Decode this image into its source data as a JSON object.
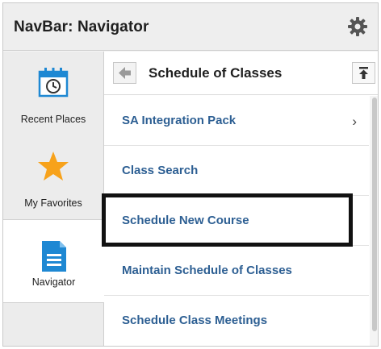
{
  "window": {
    "title": "NavBar: Navigator"
  },
  "rail": {
    "items": [
      {
        "label": "Recent Places",
        "icon": "calendar-clock-icon"
      },
      {
        "label": "My Favorites",
        "icon": "star-icon"
      },
      {
        "label": "Navigator",
        "icon": "document-icon"
      }
    ],
    "active": "Navigator"
  },
  "content": {
    "header_title": "Schedule of Classes",
    "items": [
      {
        "label": "SA Integration Pack",
        "has_chevron": true,
        "chevron": "›"
      },
      {
        "label": "Class Search",
        "has_chevron": false
      },
      {
        "label": "Schedule New Course",
        "has_chevron": false,
        "highlighted": true
      },
      {
        "label": "Maintain Schedule of Classes",
        "has_chevron": false
      },
      {
        "label": "Schedule Class Meetings",
        "has_chevron": false
      }
    ]
  },
  "colors": {
    "link_text": "#2d5f93",
    "star": "#f7a21b",
    "calendar_blue": "#1e88d3",
    "highlight_border": "#111111"
  }
}
